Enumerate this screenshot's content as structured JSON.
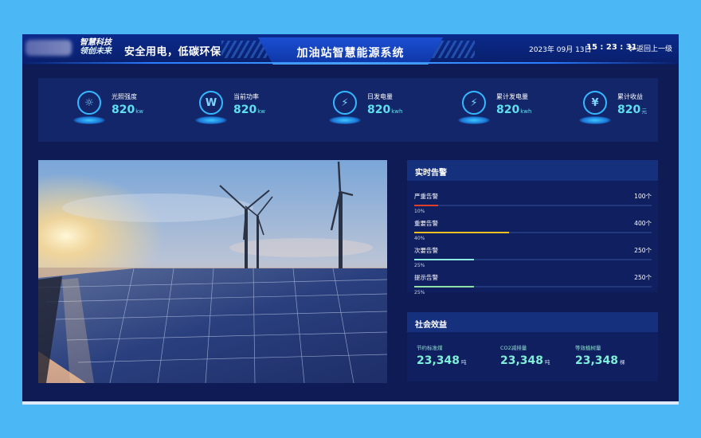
{
  "header": {
    "brand_line1": "智慧科技",
    "brand_line2": "领创未来",
    "slogan": "安全用电，低碳环保",
    "title": "加油站智慧能源系统",
    "date": "2023年 09月 13日",
    "clock": "15 : 23 : 31",
    "back_label": "返回上一级"
  },
  "stats": [
    {
      "label": "光照强度",
      "value": "820",
      "unit": "kw",
      "icon": "sun-icon",
      "glyph": "☼"
    },
    {
      "label": "当前功率",
      "value": "820",
      "unit": "kw",
      "icon": "power-w-icon",
      "glyph": "W"
    },
    {
      "label": "日发电量",
      "value": "820",
      "unit": "kwh",
      "icon": "daily-energy-icon",
      "glyph": "⚡"
    },
    {
      "label": "累计发电量",
      "value": "820",
      "unit": "kwh",
      "icon": "total-energy-icon",
      "glyph": "⚡"
    },
    {
      "label": "累计收益",
      "value": "820",
      "unit": "元",
      "icon": "money-bag-icon",
      "glyph": "¥"
    }
  ],
  "alarms": {
    "title": "实时告警",
    "items": [
      {
        "label": "严重告警",
        "count": "100个",
        "pct_label": "10%",
        "fraction": 0.1,
        "color": "#e0402a"
      },
      {
        "label": "重要告警",
        "count": "400个",
        "pct_label": "40%",
        "fraction": 0.4,
        "color": "#f0c020"
      },
      {
        "label": "次要告警",
        "count": "250个",
        "pct_label": "25%",
        "fraction": 0.25,
        "color": "#8fe8e0"
      },
      {
        "label": "提示告警",
        "count": "250个",
        "pct_label": "25%",
        "fraction": 0.25,
        "color": "#8fe0a8"
      }
    ]
  },
  "social": {
    "title": "社会效益",
    "items": [
      {
        "label": "节约标准煤",
        "value": "23,348",
        "unit": "吨"
      },
      {
        "label": "CO2减排量",
        "value": "23,348",
        "unit": "吨"
      },
      {
        "label": "等效植树量",
        "value": "23,348",
        "unit": "棵"
      }
    ]
  }
}
